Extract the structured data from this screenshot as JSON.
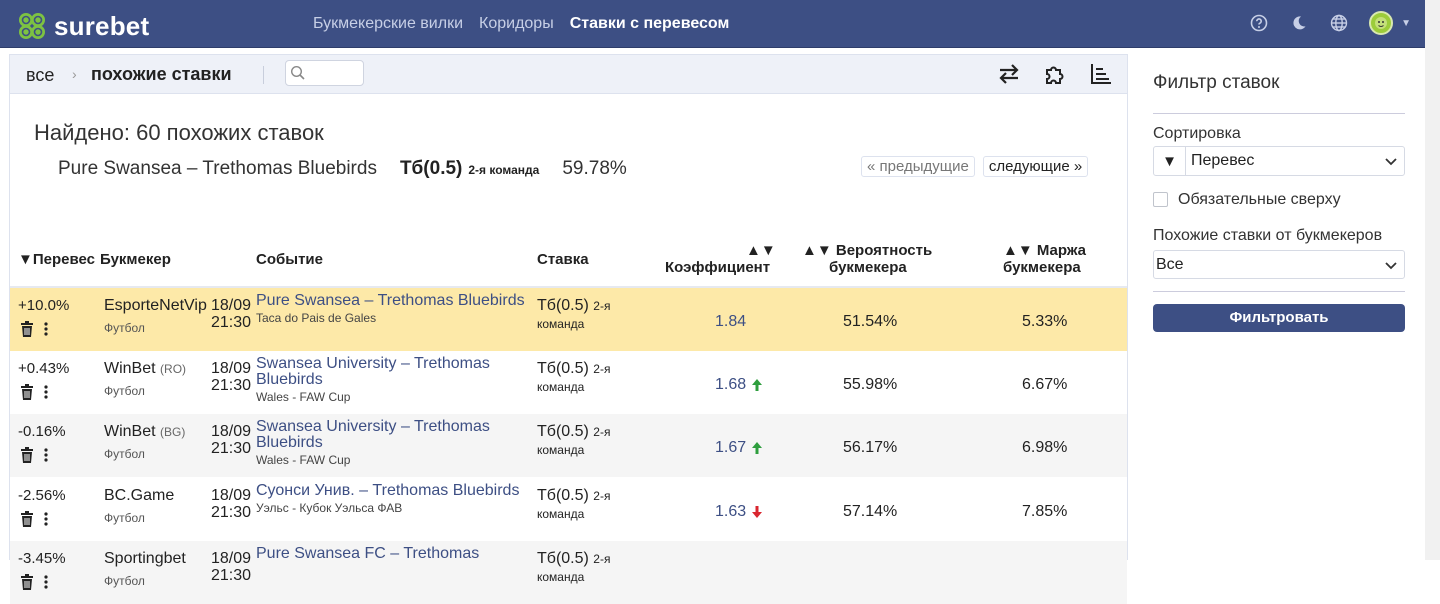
{
  "app": {
    "brand": "surebet",
    "nav": [
      {
        "label": "Букмекерские вилки",
        "active": false
      },
      {
        "label": "Коридоры",
        "active": false
      },
      {
        "label": "Ставки с перевесом",
        "active": true
      }
    ],
    "icons": [
      "help-icon",
      "moon-icon",
      "globe-icon",
      "avatar",
      "chevron-down-icon"
    ]
  },
  "breadcrumb": {
    "all": "все",
    "current": "похожие ставки"
  },
  "search": {
    "placeholder": ""
  },
  "summary": {
    "found": "Найдено: 60 похожих ставок",
    "event": "Pure Swansea – Trethomas Bluebirds",
    "bet": "Тб(0.5)",
    "team": "2-я команда",
    "percent": "59.78%",
    "prev": "« предыдущие",
    "next": "следующие »"
  },
  "table": {
    "headers": {
      "overweight": "▼Перевес",
      "bookmaker": "Букмекер",
      "event": "Событие",
      "bet": "Ставка",
      "coef_arrows": "▲▼",
      "coef": "Коэффициент",
      "prob_line1": "▲▼ Вероятность",
      "prob_line2": "букмекера",
      "margin_line1": "▲▼ Маржа",
      "margin_line2": "букмекера"
    },
    "rows": [
      {
        "overweight": "+10.0%",
        "bookmaker": "EsporteNetVip",
        "country": "",
        "sport": "Футбол",
        "date": "18/09",
        "time": "21:30",
        "event": "Pure Swansea – Trethomas Bluebirds",
        "league": "Taca do Pais de Gales",
        "bet": "Тб(0.5)",
        "bet_team": "2-я",
        "bet_team2": "команда",
        "coef": "1.84",
        "trend": "none",
        "prob": "51.54%",
        "margin": "5.33%"
      },
      {
        "overweight": "+0.43%",
        "bookmaker": "WinBet",
        "country": "(RO)",
        "sport": "Футбол",
        "date": "18/09",
        "time": "21:30",
        "event": "Swansea University – Trethomas Bluebirds",
        "league": "Wales - FAW Cup",
        "bet": "Тб(0.5)",
        "bet_team": "2-я",
        "bet_team2": "команда",
        "coef": "1.68",
        "trend": "up",
        "prob": "55.98%",
        "margin": "6.67%"
      },
      {
        "overweight": "-0.16%",
        "bookmaker": "WinBet",
        "country": "(BG)",
        "sport": "Футбол",
        "date": "18/09",
        "time": "21:30",
        "event": "Swansea University – Trethomas Bluebirds",
        "league": "Wales - FAW Cup",
        "bet": "Тб(0.5)",
        "bet_team": "2-я",
        "bet_team2": "команда",
        "coef": "1.67",
        "trend": "up",
        "prob": "56.17%",
        "margin": "6.98%"
      },
      {
        "overweight": "-2.56%",
        "bookmaker": "BC.Game",
        "country": "",
        "sport": "Футбол",
        "date": "18/09",
        "time": "21:30",
        "event": "Суонси Унив. – Trethomas Bluebirds",
        "league": "Уэльс - Кубок Уэльса ФАВ",
        "bet": "Тб(0.5)",
        "bet_team": "2-я",
        "bet_team2": "команда",
        "coef": "1.63",
        "trend": "down",
        "prob": "57.14%",
        "margin": "7.85%"
      },
      {
        "overweight": "-3.45%",
        "bookmaker": "Sportingbet",
        "country": "",
        "sport": "Футбол",
        "date": "18/09",
        "time": "21:30",
        "event": "Pure Swansea FC – Trethomas",
        "league": "",
        "bet": "Тб(0.5)",
        "bet_team": "2-я",
        "bet_team2": "команда",
        "coef": "",
        "trend": "none",
        "prob": "",
        "margin": ""
      }
    ]
  },
  "filter": {
    "title": "Фильтр ставок",
    "sort_label": "Сортировка",
    "sort_dir": "▼",
    "sort_value": "Перевес",
    "required_top": "Обязательные сверху",
    "similar_label": "Похожие ставки от букмекеров",
    "similar_value": "Все",
    "button": "Фильтровать"
  },
  "colors": {
    "brand": "#3d4f84",
    "highlight": "#fde9a8",
    "up": "#2e9e3e",
    "down": "#d9262f"
  }
}
